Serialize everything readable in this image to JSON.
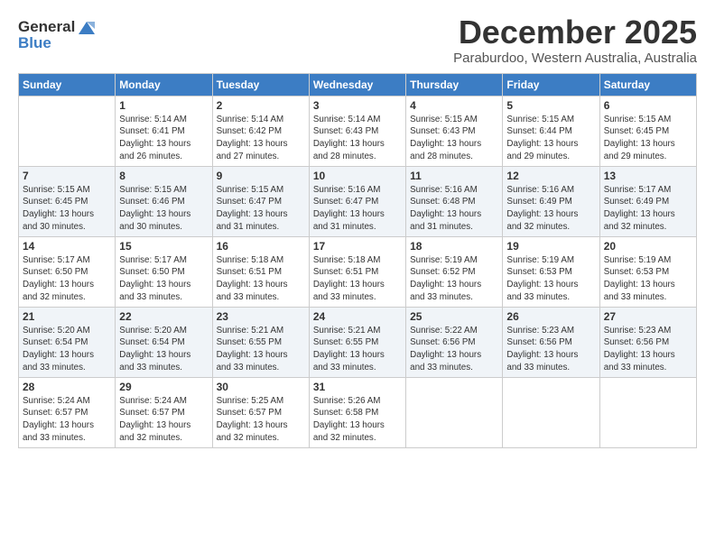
{
  "header": {
    "logo_line1": "General",
    "logo_line2": "Blue",
    "title": "December 2025",
    "subtitle": "Paraburdoo, Western Australia, Australia"
  },
  "days_of_week": [
    "Sunday",
    "Monday",
    "Tuesday",
    "Wednesday",
    "Thursday",
    "Friday",
    "Saturday"
  ],
  "weeks": [
    [
      {
        "day": "",
        "info": ""
      },
      {
        "day": "1",
        "info": "Sunrise: 5:14 AM\nSunset: 6:41 PM\nDaylight: 13 hours\nand 26 minutes."
      },
      {
        "day": "2",
        "info": "Sunrise: 5:14 AM\nSunset: 6:42 PM\nDaylight: 13 hours\nand 27 minutes."
      },
      {
        "day": "3",
        "info": "Sunrise: 5:14 AM\nSunset: 6:43 PM\nDaylight: 13 hours\nand 28 minutes."
      },
      {
        "day": "4",
        "info": "Sunrise: 5:15 AM\nSunset: 6:43 PM\nDaylight: 13 hours\nand 28 minutes."
      },
      {
        "day": "5",
        "info": "Sunrise: 5:15 AM\nSunset: 6:44 PM\nDaylight: 13 hours\nand 29 minutes."
      },
      {
        "day": "6",
        "info": "Sunrise: 5:15 AM\nSunset: 6:45 PM\nDaylight: 13 hours\nand 29 minutes."
      }
    ],
    [
      {
        "day": "7",
        "info": "Sunrise: 5:15 AM\nSunset: 6:45 PM\nDaylight: 13 hours\nand 30 minutes."
      },
      {
        "day": "8",
        "info": "Sunrise: 5:15 AM\nSunset: 6:46 PM\nDaylight: 13 hours\nand 30 minutes."
      },
      {
        "day": "9",
        "info": "Sunrise: 5:15 AM\nSunset: 6:47 PM\nDaylight: 13 hours\nand 31 minutes."
      },
      {
        "day": "10",
        "info": "Sunrise: 5:16 AM\nSunset: 6:47 PM\nDaylight: 13 hours\nand 31 minutes."
      },
      {
        "day": "11",
        "info": "Sunrise: 5:16 AM\nSunset: 6:48 PM\nDaylight: 13 hours\nand 31 minutes."
      },
      {
        "day": "12",
        "info": "Sunrise: 5:16 AM\nSunset: 6:49 PM\nDaylight: 13 hours\nand 32 minutes."
      },
      {
        "day": "13",
        "info": "Sunrise: 5:17 AM\nSunset: 6:49 PM\nDaylight: 13 hours\nand 32 minutes."
      }
    ],
    [
      {
        "day": "14",
        "info": "Sunrise: 5:17 AM\nSunset: 6:50 PM\nDaylight: 13 hours\nand 32 minutes."
      },
      {
        "day": "15",
        "info": "Sunrise: 5:17 AM\nSunset: 6:50 PM\nDaylight: 13 hours\nand 33 minutes."
      },
      {
        "day": "16",
        "info": "Sunrise: 5:18 AM\nSunset: 6:51 PM\nDaylight: 13 hours\nand 33 minutes."
      },
      {
        "day": "17",
        "info": "Sunrise: 5:18 AM\nSunset: 6:51 PM\nDaylight: 13 hours\nand 33 minutes."
      },
      {
        "day": "18",
        "info": "Sunrise: 5:19 AM\nSunset: 6:52 PM\nDaylight: 13 hours\nand 33 minutes."
      },
      {
        "day": "19",
        "info": "Sunrise: 5:19 AM\nSunset: 6:53 PM\nDaylight: 13 hours\nand 33 minutes."
      },
      {
        "day": "20",
        "info": "Sunrise: 5:19 AM\nSunset: 6:53 PM\nDaylight: 13 hours\nand 33 minutes."
      }
    ],
    [
      {
        "day": "21",
        "info": "Sunrise: 5:20 AM\nSunset: 6:54 PM\nDaylight: 13 hours\nand 33 minutes."
      },
      {
        "day": "22",
        "info": "Sunrise: 5:20 AM\nSunset: 6:54 PM\nDaylight: 13 hours\nand 33 minutes."
      },
      {
        "day": "23",
        "info": "Sunrise: 5:21 AM\nSunset: 6:55 PM\nDaylight: 13 hours\nand 33 minutes."
      },
      {
        "day": "24",
        "info": "Sunrise: 5:21 AM\nSunset: 6:55 PM\nDaylight: 13 hours\nand 33 minutes."
      },
      {
        "day": "25",
        "info": "Sunrise: 5:22 AM\nSunset: 6:56 PM\nDaylight: 13 hours\nand 33 minutes."
      },
      {
        "day": "26",
        "info": "Sunrise: 5:23 AM\nSunset: 6:56 PM\nDaylight: 13 hours\nand 33 minutes."
      },
      {
        "day": "27",
        "info": "Sunrise: 5:23 AM\nSunset: 6:56 PM\nDaylight: 13 hours\nand 33 minutes."
      }
    ],
    [
      {
        "day": "28",
        "info": "Sunrise: 5:24 AM\nSunset: 6:57 PM\nDaylight: 13 hours\nand 33 minutes."
      },
      {
        "day": "29",
        "info": "Sunrise: 5:24 AM\nSunset: 6:57 PM\nDaylight: 13 hours\nand 32 minutes."
      },
      {
        "day": "30",
        "info": "Sunrise: 5:25 AM\nSunset: 6:57 PM\nDaylight: 13 hours\nand 32 minutes."
      },
      {
        "day": "31",
        "info": "Sunrise: 5:26 AM\nSunset: 6:58 PM\nDaylight: 13 hours\nand 32 minutes."
      },
      {
        "day": "",
        "info": ""
      },
      {
        "day": "",
        "info": ""
      },
      {
        "day": "",
        "info": ""
      }
    ]
  ]
}
